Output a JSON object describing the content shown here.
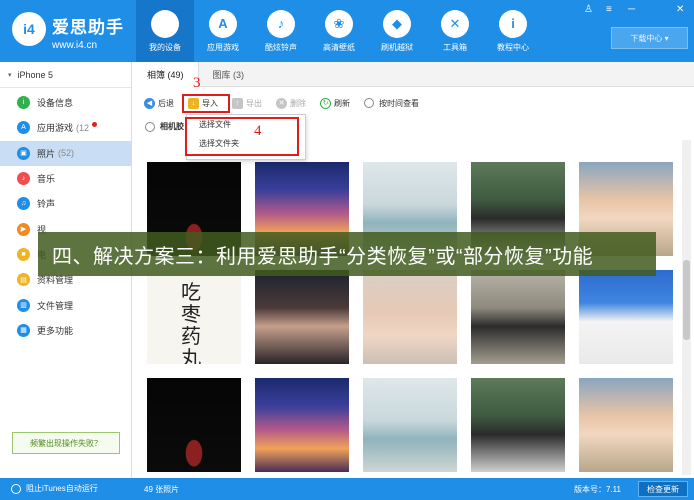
{
  "brand": {
    "logo_text": "i4",
    "name": "爱思助手",
    "url": "www.i4.cn"
  },
  "nav": [
    {
      "label": "我的设备",
      "icon": "apple-icon",
      "glyph": "",
      "active": true
    },
    {
      "label": "应用游戏",
      "icon": "app-store-icon",
      "glyph": "A"
    },
    {
      "label": "酷炫铃声",
      "icon": "bell-icon",
      "glyph": "♪"
    },
    {
      "label": "高清壁纸",
      "icon": "flower-icon",
      "glyph": "❀"
    },
    {
      "label": "刷机越狱",
      "icon": "dropbox-icon",
      "glyph": "◆"
    },
    {
      "label": "工具箱",
      "icon": "tools-icon",
      "glyph": "✕"
    },
    {
      "label": "教程中心",
      "icon": "info-icon",
      "glyph": "i"
    }
  ],
  "window_controls": {
    "shirt": "♙",
    "menu": "≡",
    "minimize": "─",
    "close": "✕"
  },
  "download_center": "下载中心 ▾",
  "device": {
    "label": "iPhone 5",
    "toggle": "▾"
  },
  "sidebar": {
    "items": [
      {
        "label": "设备信息",
        "icon": "info-icon",
        "glyph": "i",
        "color": "#2fb24d"
      },
      {
        "label": "应用游戏",
        "count": "(12",
        "icon": "app-store-icon",
        "glyph": "A",
        "color": "#1f8ee6"
      },
      {
        "label": "照片",
        "count": "(52)",
        "icon": "photos-icon",
        "glyph": "▣",
        "color": "#1f8ee6"
      },
      {
        "label": "音乐",
        "icon": "music-icon",
        "glyph": "♪",
        "color": "#ef4f4f"
      },
      {
        "label": "铃声",
        "icon": "bell-icon",
        "glyph": "♫",
        "color": "#1f8ee6"
      },
      {
        "label": "视",
        "icon": "video-icon",
        "glyph": "▶",
        "color": "#f08a24"
      },
      {
        "label": "电",
        "icon": "ebook-icon",
        "glyph": "■",
        "color": "#f0b324"
      },
      {
        "label": "资料管理",
        "icon": "contacts-icon",
        "glyph": "▤",
        "color": "#f0b324"
      },
      {
        "label": "文件管理",
        "icon": "folder-icon",
        "glyph": "▥",
        "color": "#1f8ee6"
      },
      {
        "label": "更多功能",
        "icon": "grid-icon",
        "glyph": "▦",
        "color": "#1f8ee6"
      }
    ],
    "help_button": "频繁出现操作失败？"
  },
  "tabs": [
    {
      "label": "相簿 (49)",
      "active": true
    },
    {
      "label": "图库 (3)"
    }
  ],
  "toolbar": {
    "back": "后退",
    "import": "导入",
    "export": "导出",
    "delete": "删除",
    "refresh": "刷新",
    "sort_by_time": "按时间查看"
  },
  "filter": {
    "camera_roll": "相机胶"
  },
  "dropdown": {
    "items": [
      "选择文件",
      "选择文件夹"
    ]
  },
  "annotations": {
    "step3": "3",
    "step4": "4"
  },
  "banner": "四、解决方案三：利用爱思助手“分类恢复”或“部分恢复”功能",
  "calligraphy": [
    "吃",
    "枣",
    "药",
    "丸"
  ],
  "photos": [
    [
      "ph-car",
      "ph-sunset",
      "ph-beach",
      "ph-man",
      "ph-girl"
    ],
    [
      "ph-calli",
      "ph-woman-dark",
      "ph-hands",
      "ph-sitting",
      "ph-spurs"
    ],
    [
      "ph-car",
      "ph-sunset",
      "ph-beach",
      "ph-man",
      "ph-girl"
    ]
  ],
  "status": {
    "itunes": "阻止iTunes自动运行",
    "photo_count": "49 张照片",
    "version": "版本号：7.11",
    "update": "检查更新"
  }
}
